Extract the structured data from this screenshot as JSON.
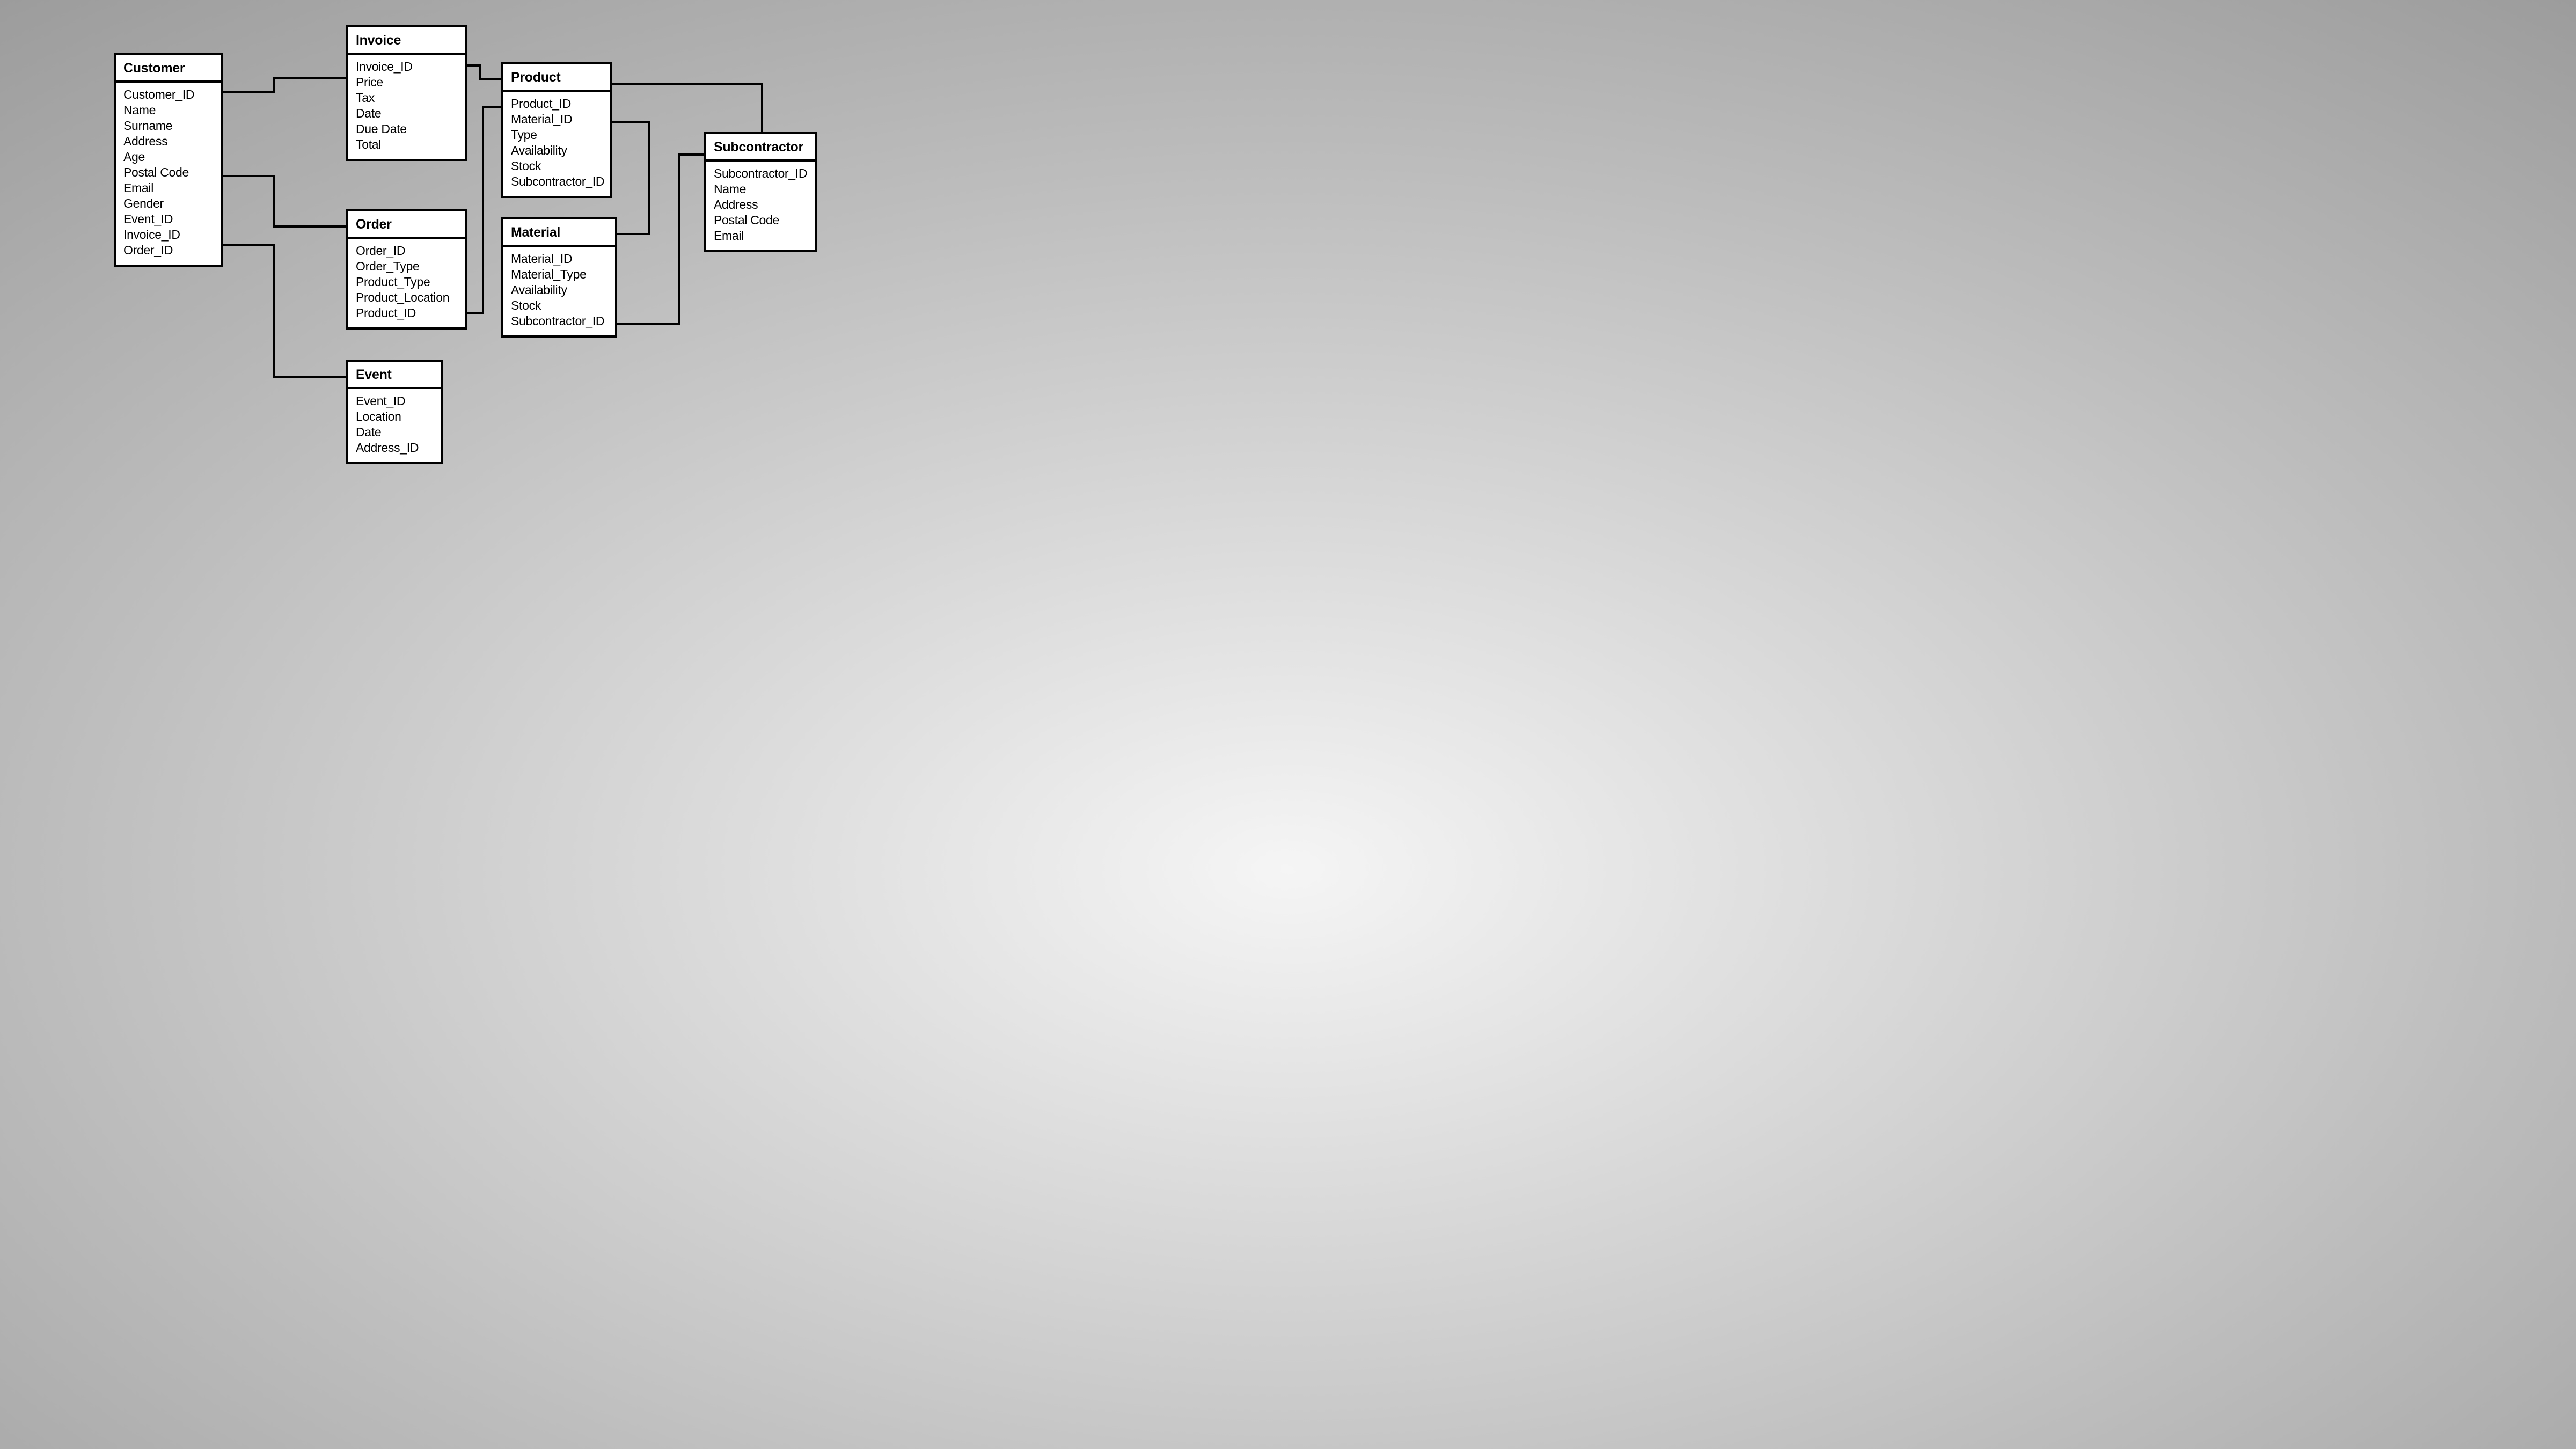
{
  "entities": {
    "customer": {
      "title": "Customer",
      "fields": [
        "Customer_ID",
        "Name",
        "Surname",
        "Address",
        "Age",
        "Postal Code",
        "Email",
        "Gender",
        "Event_ID",
        "Invoice_ID",
        "Order_ID"
      ]
    },
    "invoice": {
      "title": "Invoice",
      "fields": [
        "Invoice_ID",
        "Price",
        "Tax",
        "Date",
        "Due Date",
        "Total"
      ]
    },
    "order": {
      "title": "Order",
      "fields": [
        "Order_ID",
        "Order_Type",
        "Product_Type",
        "Product_Location",
        "Product_ID"
      ]
    },
    "event": {
      "title": "Event",
      "fields": [
        "Event_ID",
        "Location",
        "Date",
        "Address_ID"
      ]
    },
    "product": {
      "title": "Product",
      "fields": [
        "Product_ID",
        "Material_ID",
        "Type",
        "Availability",
        "Stock",
        "Subcontractor_ID"
      ]
    },
    "material": {
      "title": "Material",
      "fields": [
        "Material_ID",
        "Material_Type",
        "Availability",
        "Stock",
        "Subcontractor_ID"
      ]
    },
    "subcontractor": {
      "title": "Subcontractor",
      "fields": [
        "Subcontractor_ID",
        "Name",
        "Address",
        "Postal Code",
        "Email"
      ]
    }
  }
}
